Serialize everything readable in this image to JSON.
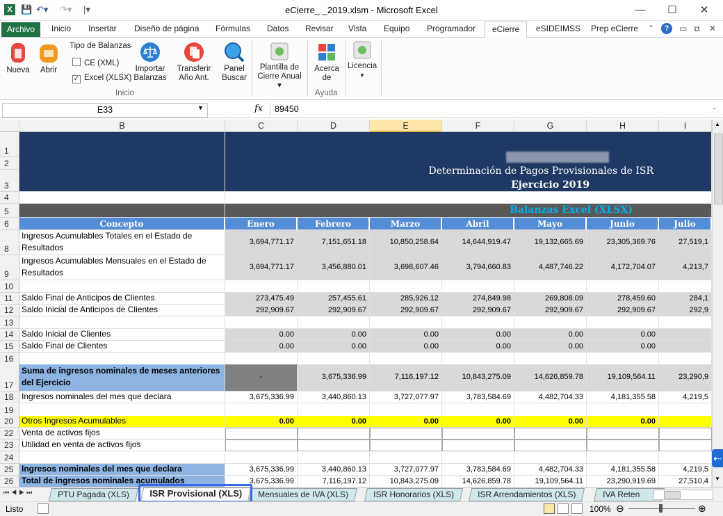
{
  "window": {
    "title": "eCierre_                    _2019.xlsm - Microsoft Excel",
    "minimize_glyph": "—",
    "maximize_glyph": "☐",
    "close_glyph": "✕"
  },
  "ribbon_tabs": [
    "Archivo",
    "Inicio",
    "Insertar",
    "Diseño de página",
    "Fórmulas",
    "Datos",
    "Revisar",
    "Vista",
    "Equipo",
    "Programador",
    "eCierre",
    "eSIDEIMSS",
    "Prep eCierre"
  ],
  "ribbon": {
    "nueva": "Nueva",
    "abrir": "Abrir",
    "tipo_balanzas": "Tipo de Balanzas",
    "ce_xml": "CE (XML)",
    "excel_xlsx": "Excel (XLSX)",
    "importar": [
      "Importar",
      "Balanzas"
    ],
    "transferir": [
      "Transferir",
      "Año Ant."
    ],
    "panel": [
      "Panel",
      "Buscar"
    ],
    "plantilla": [
      "Plantilla de",
      "Cierre Anual ▾"
    ],
    "acerca": [
      "Acerca",
      "de"
    ],
    "licencia": "Licencia",
    "group_inicio": "Inicio",
    "group_ayuda": "Ayuda",
    "colors": {
      "archivo": "#217346",
      "accent": "#2b579a"
    }
  },
  "formula_bar": {
    "name_box": "E33",
    "fx": "fx",
    "formula": "89450"
  },
  "sheet": {
    "columns": [
      "B",
      "C",
      "D",
      "E",
      "F",
      "G",
      "H",
      "I"
    ],
    "selected_column": "E",
    "title": "Determinación de Pagos Provisionales de ISR",
    "subtitle": "Ejercicio 2019",
    "section": "Balanzas Excel (XLSX)",
    "header": [
      "Concepto",
      "Enero",
      "Febrero",
      "Marzo",
      "Abril",
      "Mayo",
      "Junio",
      "Julio"
    ],
    "rows": [
      {
        "n": "8",
        "label": "Ingresos Acumulables Totales en el Estado de Resultados",
        "vals": [
          "3,694,771.17",
          "7,151,651.18",
          "10,850,258.64",
          "14,644,919.47",
          "19,132,665.69",
          "23,305,369.76",
          "27,519,1"
        ]
      },
      {
        "n": "9",
        "label": "Ingresos Acumulables Mensuales en el Estado de Resultados",
        "vals": [
          "3,694,771.17",
          "3,456,880.01",
          "3,698,607.46",
          "3,794,660.83",
          "4,487,746.22",
          "4,172,704.07",
          "4,213,7"
        ]
      },
      {
        "n": "10",
        "label": "",
        "vals": [
          "",
          "",
          "",
          "",
          "",
          "",
          ""
        ]
      },
      {
        "n": "11",
        "label": "Saldo Final de Anticipos de Clientes",
        "vals": [
          "273,475.49",
          "257,455.61",
          "285,926.12",
          "274,849.98",
          "269,808.09",
          "278,459.60",
          "284,1"
        ]
      },
      {
        "n": "12",
        "label": "Saldo Inicial de Anticipos de Clientes",
        "vals": [
          "292,909.67",
          "292,909.67",
          "292,909.67",
          "292,909.67",
          "292,909.67",
          "292,909.67",
          "292,9"
        ]
      },
      {
        "n": "13",
        "label": "",
        "vals": [
          "",
          "",
          "",
          "",
          "",
          "",
          ""
        ]
      },
      {
        "n": "14",
        "label": "Saldo Inicial de Clientes",
        "vals": [
          "0.00",
          "0.00",
          "0.00",
          "0.00",
          "0.00",
          "0.00",
          ""
        ]
      },
      {
        "n": "15",
        "label": "Saldo Final de Clientes",
        "vals": [
          "0.00",
          "0.00",
          "0.00",
          "0.00",
          "0.00",
          "0.00",
          ""
        ]
      },
      {
        "n": "16",
        "label": "",
        "vals": [
          "",
          "",
          "",
          "",
          "",
          "",
          ""
        ]
      },
      {
        "n": "17",
        "label": "Suma de ingresos nominales de meses anteriores del Ejercicio",
        "vals": [
          "-",
          "3,675,336.99",
          "7,116,197.12",
          "10,843,275.09",
          "14,626,859.78",
          "19,109,564.11",
          "23,290,9"
        ]
      },
      {
        "n": "18",
        "label": "Ingresos nominales del mes que declara",
        "vals": [
          "3,675,336.99",
          "3,440,860.13",
          "3,727,077.97",
          "3,783,584.69",
          "4,482,704.33",
          "4,181,355.58",
          "4,219,5"
        ]
      },
      {
        "n": "19",
        "label": "",
        "vals": [
          "",
          "",
          "",
          "",
          "",
          "",
          ""
        ]
      },
      {
        "n": "20",
        "label": "Otros Ingresos Acumulables",
        "vals": [
          "0.00",
          "0.00",
          "0.00",
          "0.00",
          "0.00",
          "0.00",
          ""
        ]
      },
      {
        "n": "22",
        "label": "Venta de activos fijos",
        "vals": [
          "",
          "",
          "",
          "",
          "",
          "",
          ""
        ]
      },
      {
        "n": "23",
        "label": "Utilidad en venta de activos fijos",
        "vals": [
          "",
          "",
          "",
          "",
          "",
          "",
          ""
        ]
      },
      {
        "n": "24",
        "label": "",
        "vals": [
          "",
          "",
          "",
          "",
          "",
          "",
          ""
        ]
      },
      {
        "n": "25",
        "label": "Ingresos nominales del mes que declara",
        "vals": [
          "3,675,336.99",
          "3,440,860.13",
          "3,727,077.97",
          "3,783,584.69",
          "4,482,704.33",
          "4,181,355.58",
          "4,219,5"
        ]
      },
      {
        "n": "26",
        "label": "Total de ingresos nominales acumulados",
        "vals": [
          "3,675,336.99",
          "7,116,197.12",
          "10,843,275.09",
          "14,626,859.78",
          "19,109,564.11",
          "23,290,919.69",
          "27,510,4"
        ]
      }
    ]
  },
  "sheet_tabs": [
    "PTU Pagada (XLS)",
    "ISR Provisional (XLS)",
    "Mensuales de IVA (XLS)",
    "ISR Honorarios (XLS)",
    "ISR Arrendamientos (XLS)",
    "IVA Reten"
  ],
  "status": {
    "ready": "Listo",
    "zoom": "100%"
  }
}
